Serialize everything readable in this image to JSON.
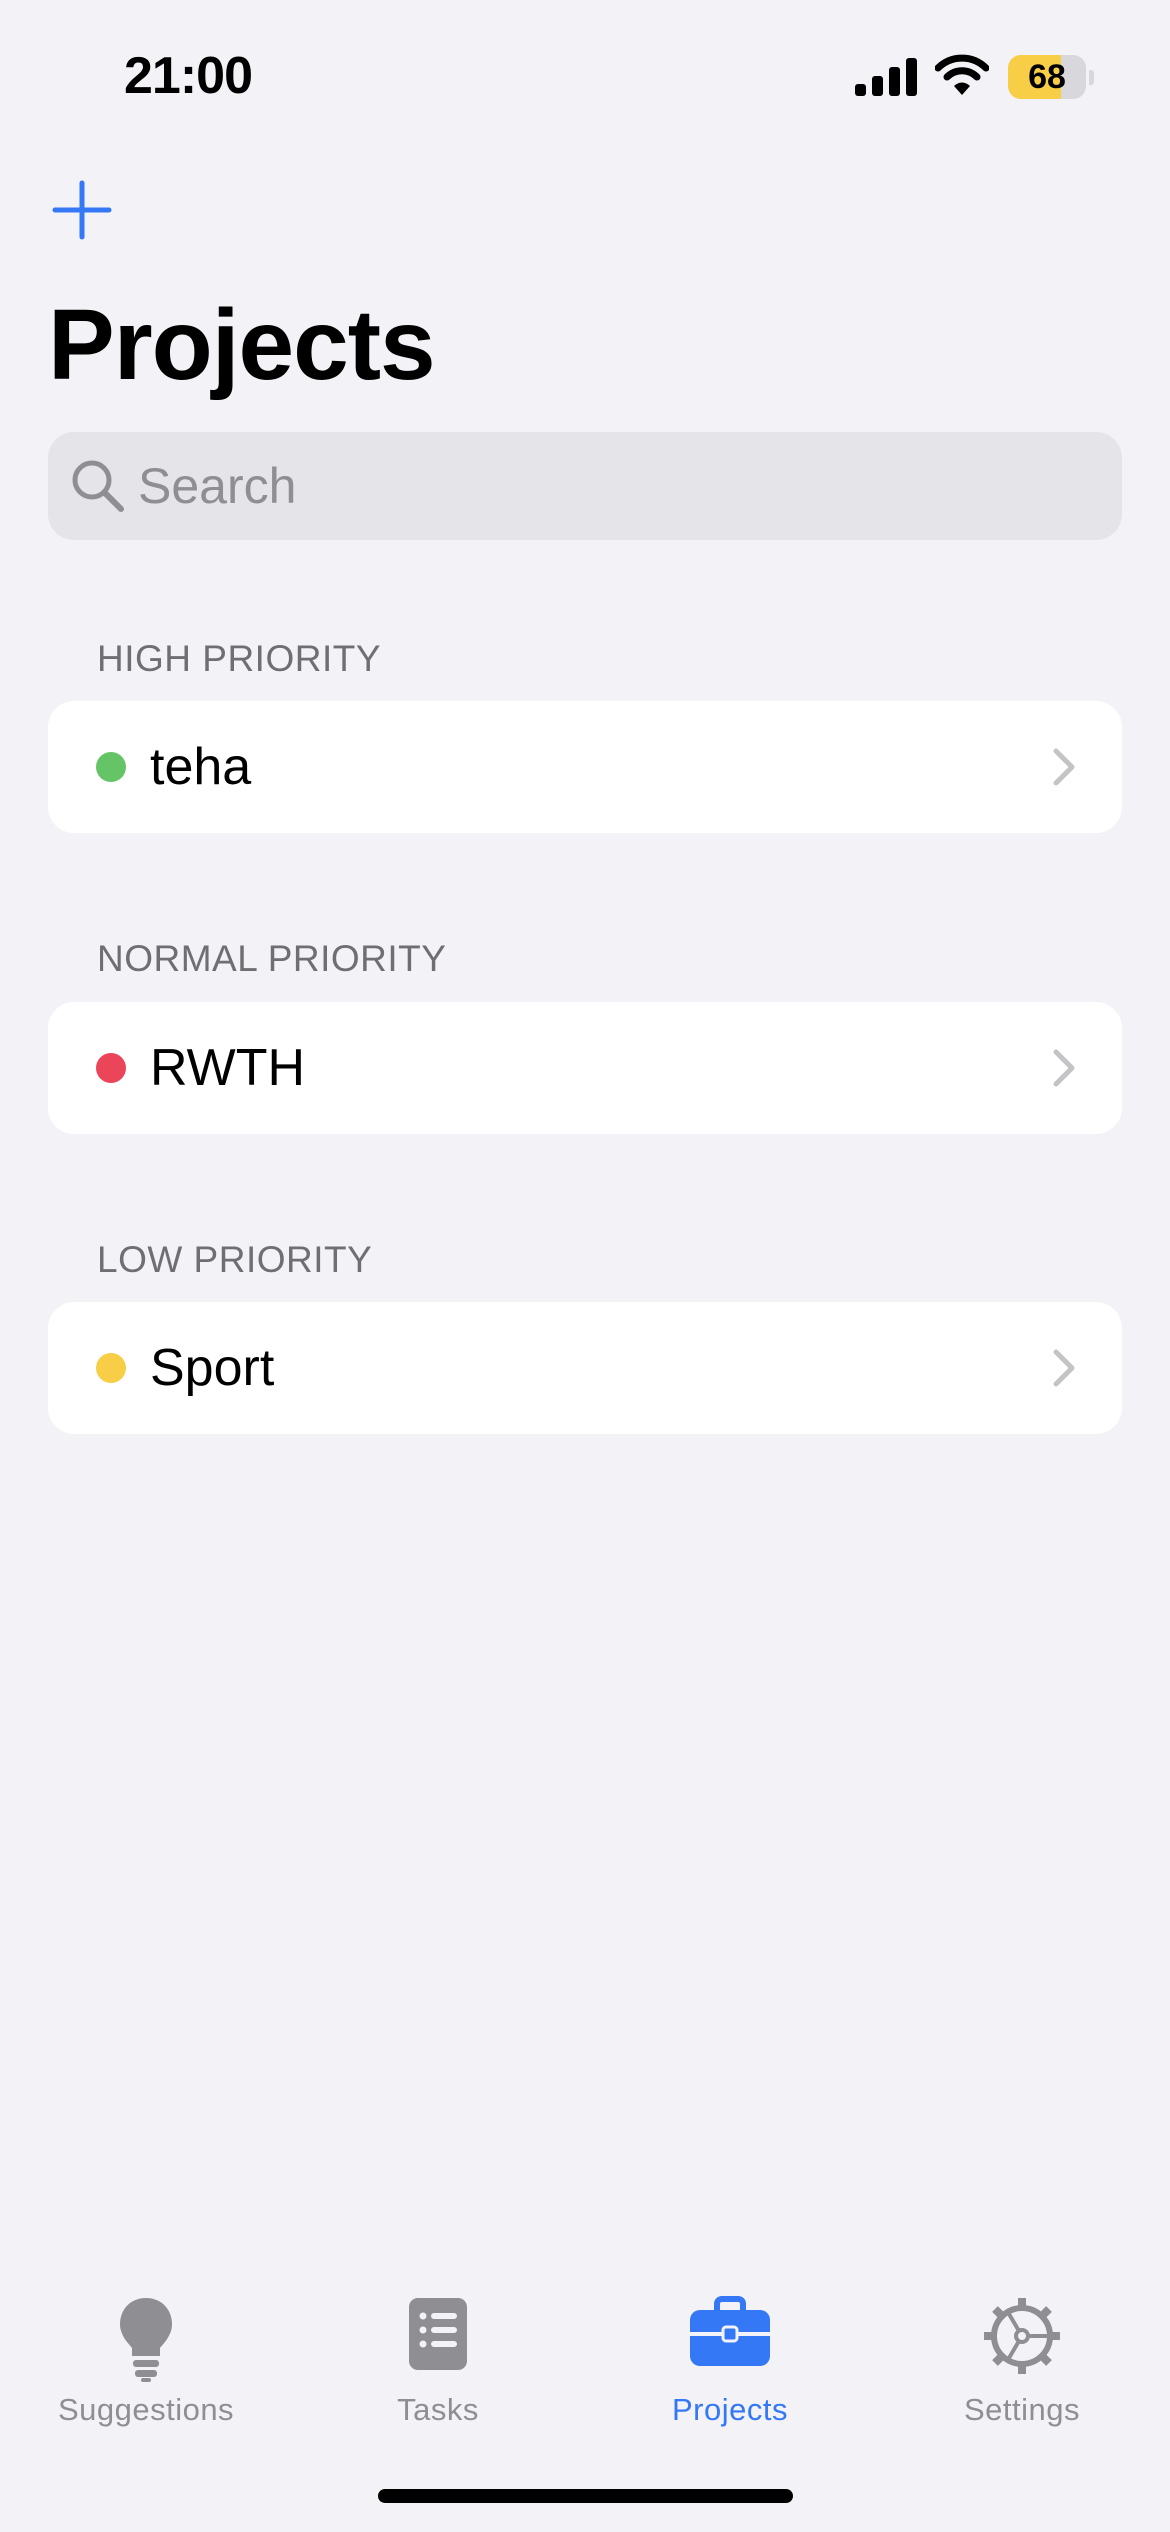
{
  "status_bar": {
    "time": "21:00",
    "battery_level": "68",
    "battery_fraction": 0.68,
    "battery_fill_color": "#f7ce46",
    "icons": [
      "signal-icon",
      "wifi-icon",
      "battery-icon"
    ]
  },
  "header": {
    "add_icon": "plus-icon",
    "title": "Projects"
  },
  "search": {
    "placeholder": "Search",
    "value": ""
  },
  "sections": [
    {
      "header": "HIGH PRIORITY",
      "projects": [
        {
          "name": "teha",
          "color": "#65c466"
        }
      ]
    },
    {
      "header": "NORMAL PRIORITY",
      "projects": [
        {
          "name": "RWTH",
          "color": "#eb4559"
        }
      ]
    },
    {
      "header": "LOW PRIORITY",
      "projects": [
        {
          "name": "Sport",
          "color": "#f7ce46"
        }
      ]
    }
  ],
  "tab_bar": {
    "active_color": "#3478f6",
    "inactive_color": "#8e8e93",
    "tabs": [
      {
        "label": "Suggestions",
        "icon": "lightbulb-icon",
        "active": false
      },
      {
        "label": "Tasks",
        "icon": "task-list-icon",
        "active": false
      },
      {
        "label": "Projects",
        "icon": "briefcase-icon",
        "active": true
      },
      {
        "label": "Settings",
        "icon": "gear-icon",
        "active": false
      }
    ]
  }
}
